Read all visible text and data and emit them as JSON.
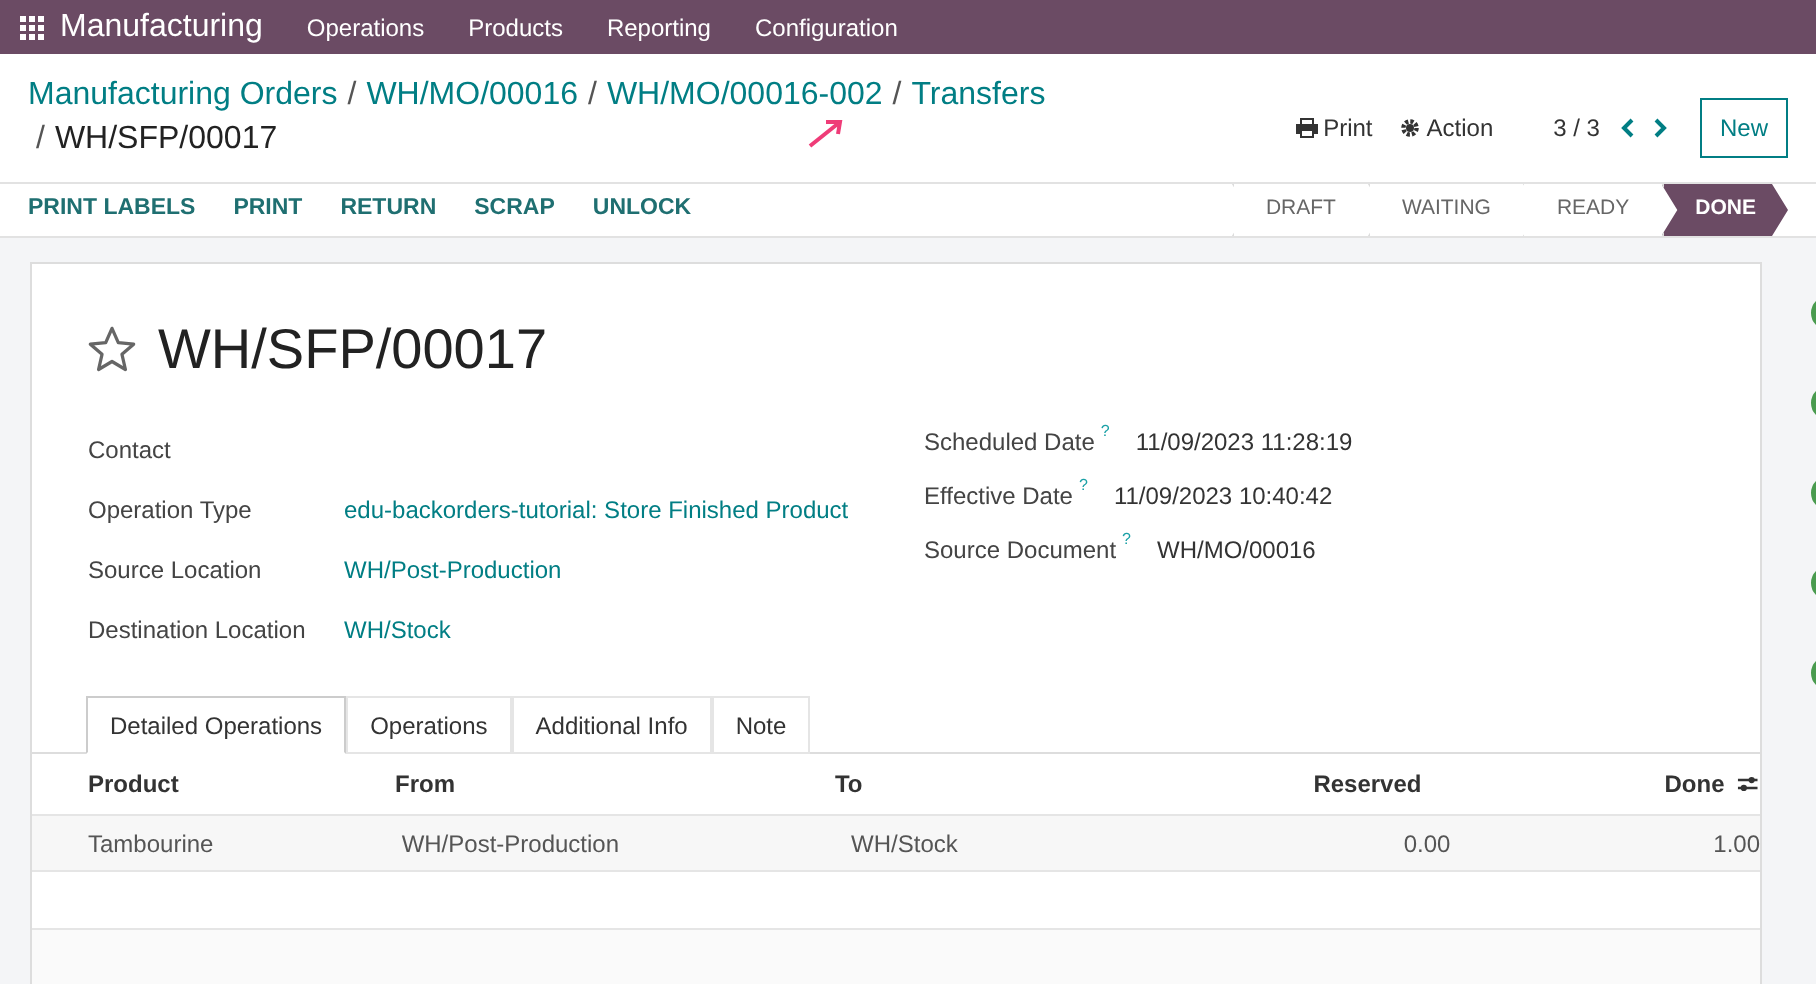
{
  "navbar": {
    "app": "Manufacturing",
    "menus": [
      "Operations",
      "Products",
      "Reporting",
      "Configuration"
    ]
  },
  "breadcrumbs": [
    "Manufacturing Orders",
    "WH/MO/00016",
    "WH/MO/00016-002",
    "Transfers"
  ],
  "separator": "/",
  "current": "WH/SFP/00017",
  "controls": {
    "print": "Print",
    "action": "Action",
    "pager": "3 / 3",
    "new": "New"
  },
  "action_buttons": [
    "PRINT LABELS",
    "PRINT",
    "RETURN",
    "SCRAP",
    "UNLOCK"
  ],
  "stages": [
    {
      "label": "DRAFT",
      "selected": false
    },
    {
      "label": "WAITING",
      "selected": false
    },
    {
      "label": "READY",
      "selected": false
    },
    {
      "label": "DONE",
      "selected": true
    }
  ],
  "record": {
    "title": "WH/SFP/00017",
    "starred": false
  },
  "left_fields": [
    {
      "label": "Contact"
    },
    {
      "label": "Operation Type",
      "value": "edu-backorders-tutorial: Store Finished Product"
    },
    {
      "label": "Source Location",
      "value": "WH/Post-Production"
    },
    {
      "label": "Destination Location",
      "value": "WH/Stock"
    }
  ],
  "right_fields": [
    {
      "label": "Scheduled Date",
      "help": "?",
      "value": "11/09/2023 11:28:19"
    },
    {
      "label": "Effective Date",
      "help": "?",
      "value": "11/09/2023 10:40:42"
    },
    {
      "label": "Source Document",
      "help": "?",
      "value": "WH/MO/00016"
    }
  ],
  "tabs": [
    {
      "label": "Detailed Operations",
      "selected": true
    },
    {
      "label": "Operations",
      "selected": false
    },
    {
      "label": "Additional Info",
      "selected": false
    },
    {
      "label": "Note",
      "selected": false
    }
  ],
  "table": {
    "columns": [
      "Product",
      "From",
      "To",
      "Reserved",
      "Done"
    ],
    "rows": [
      [
        "Tambourine",
        "WH/Post-Production",
        "WH/Stock",
        "0.00",
        "1.00"
      ]
    ]
  }
}
